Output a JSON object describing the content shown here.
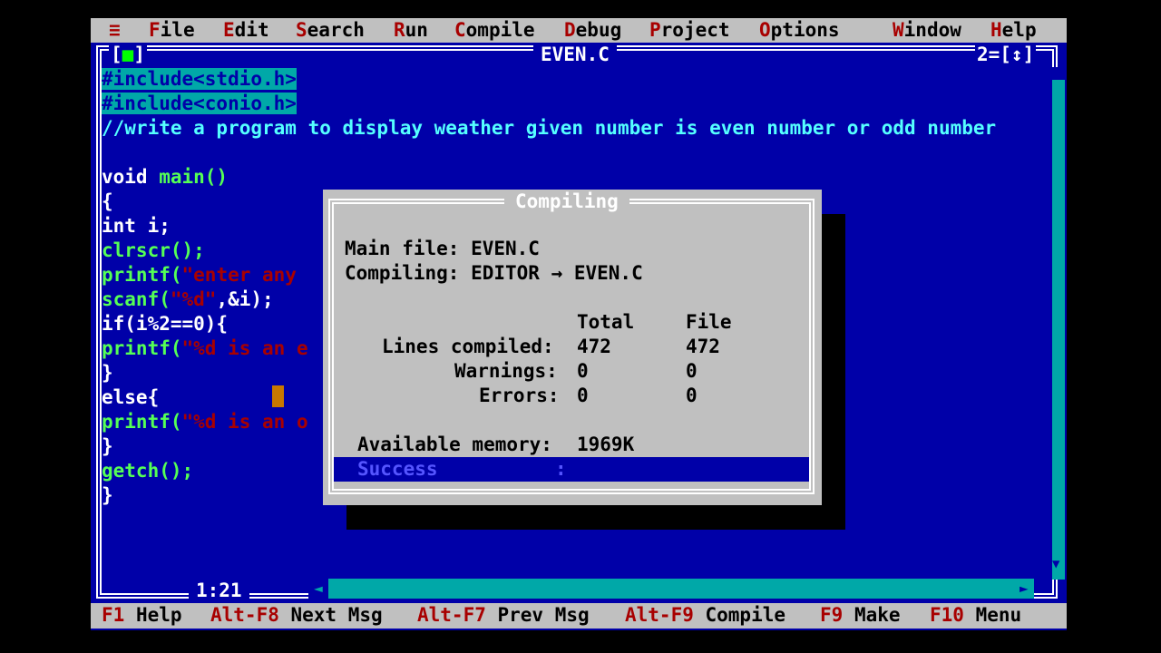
{
  "menu": {
    "system": "≡",
    "items": [
      {
        "hot": "F",
        "rest": "ile"
      },
      {
        "hot": "E",
        "rest": "dit"
      },
      {
        "hot": "S",
        "rest": "earch"
      },
      {
        "hot": "R",
        "rest": "un"
      },
      {
        "hot": "C",
        "rest": "ompile"
      },
      {
        "hot": "D",
        "rest": "ebug"
      },
      {
        "hot": "P",
        "rest": "roject"
      },
      {
        "hot": "O",
        "rest": "ptions"
      },
      {
        "hot": "W",
        "rest": "indow"
      },
      {
        "hot": "H",
        "rest": "elp"
      }
    ]
  },
  "window": {
    "close": "[■]",
    "title": "EVEN.C",
    "number": "2=[↕]"
  },
  "code": {
    "l1": "#include<stdio.h>",
    "l2": "#include<conio.h>",
    "l3": "//write a program to display weather given number is even number or odd number",
    "l5a": "void",
    "l5b": " main()",
    "l6": "{",
    "l7": "int i;",
    "l8": "clrscr();",
    "l9a": "printf(",
    "l9b": "\"enter any",
    "l10a": "scanf(",
    "l10b": "\"%d\"",
    "l10c": ",&i);",
    "l11": "if(i%2==0){",
    "l12a": "printf(",
    "l12b": "\"%d is an e",
    "l13": "}",
    "l14": "else{",
    "l15a": "printf(",
    "l15b": "\"%d is an o",
    "l16": "}",
    "l17": "getch();",
    "l18": "}"
  },
  "position": "1:21",
  "dialog": {
    "title": "Compiling",
    "main_file": "Main file: EVEN.C",
    "compiling": "Compiling: EDITOR → EVEN.C",
    "col_total": "Total",
    "col_file": "File",
    "lines_label": "Lines compiled:",
    "lines_total": "472",
    "lines_file": "472",
    "warn_label": "Warnings:",
    "warn_total": "0",
    "warn_file": "0",
    "err_label": "Errors:",
    "err_total": "0",
    "err_file": "0",
    "mem_label": "Available memory:",
    "mem_value": "1969K",
    "status": "Success",
    "status_colon": ":"
  },
  "status_bar": [
    {
      "key": "F1",
      "label": " Help"
    },
    {
      "key": "Alt-F8",
      "label": " Next Msg"
    },
    {
      "key": "Alt-F7",
      "label": " Prev Msg"
    },
    {
      "key": "Alt-F9",
      "label": " Compile"
    },
    {
      "key": "F9",
      "label": " Make"
    },
    {
      "key": "F10",
      "label": " Menu"
    }
  ]
}
